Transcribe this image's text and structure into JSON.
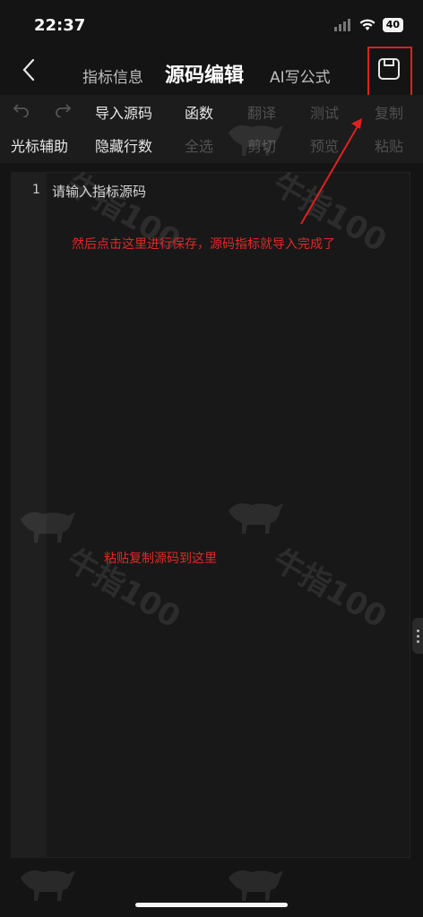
{
  "status": {
    "time": "22:37",
    "battery": "40"
  },
  "header": {
    "tab_info": "指标信息",
    "tab_source": "源码编辑",
    "tab_ai": "AI写公式"
  },
  "toolbar1": {
    "import_source": "导入源码",
    "functions": "函数",
    "translate": "翻译",
    "test": "测试",
    "copy": "复制"
  },
  "toolbar2": {
    "cursor_assist": "光标辅助",
    "hide_lines": "隐藏行数",
    "select_all": "全选",
    "cut": "剪切",
    "preview": "预览",
    "paste": "粘贴"
  },
  "editor": {
    "line_number": "1",
    "placeholder": "请输入指标源码"
  },
  "annotations": {
    "save_hint": "然后点击这里进行保存，源码指标就导入完成了",
    "paste_hint": "粘贴复制源码到这里"
  },
  "watermark": {
    "text": "牛指100"
  },
  "colors": {
    "accent_red": "#e02020",
    "background": "#141414"
  }
}
